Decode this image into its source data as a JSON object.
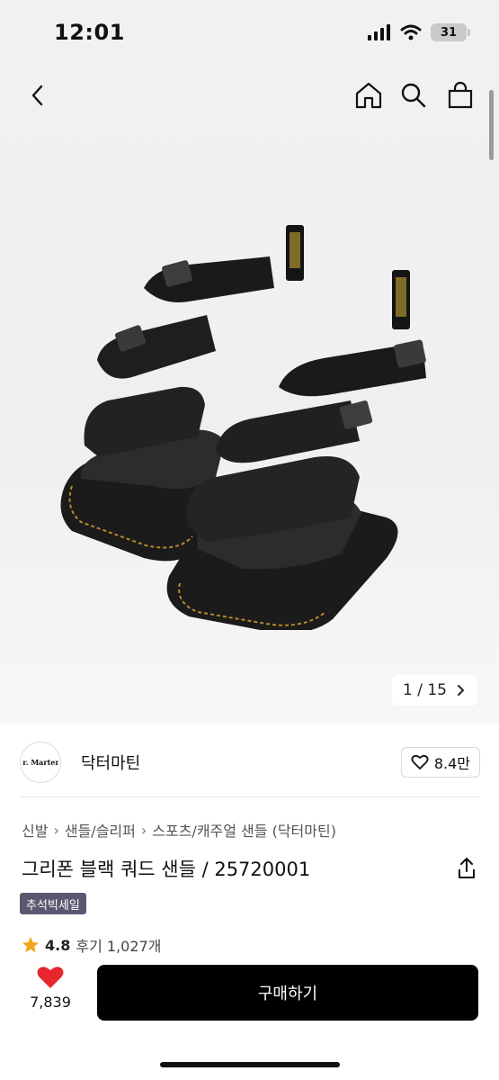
{
  "status_bar": {
    "time": "12:01",
    "battery": "31"
  },
  "nav": {
    "back_icon": "chevron-left-icon",
    "home_icon": "home-icon",
    "search_icon": "search-icon",
    "bag_icon": "shopping-bag-icon"
  },
  "gallery": {
    "current": "1",
    "total": "15",
    "counter": "1 / 15"
  },
  "brand": {
    "name": "닥터마틴",
    "logo_text": "Dr. Martens",
    "likes": "8.4만"
  },
  "breadcrumb": [
    "신발",
    "샌들/슬리퍼",
    "스포츠/캐주얼 샌들 (닥터마틴)"
  ],
  "product": {
    "title": "그리폰 블랙 쿼드 샌들 / 25720001",
    "badge": "추석빅세일"
  },
  "rating": {
    "score": "4.8",
    "reviews": "후기 1,027개"
  },
  "bottom": {
    "wish_count": "7,839",
    "buy_label": "구매하기"
  },
  "colors": {
    "accent": "#000000",
    "heart": "#e8262d",
    "star": "#f2a516",
    "badge": "#5c5670"
  }
}
